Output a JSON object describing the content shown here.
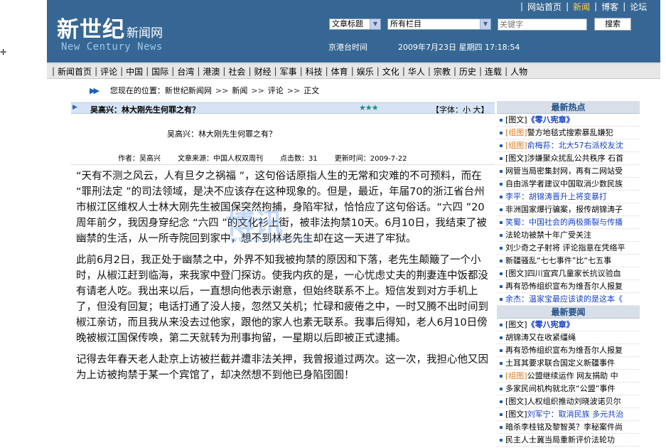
{
  "header": {
    "logo_cn": "新世纪",
    "logo_sub": "新闻网",
    "logo_en": "New Century News",
    "search_field_select": "文章标题",
    "search_column_select": "所有栏目",
    "keyword_placeholder": "关键字",
    "search_button": "搜索",
    "time_label": "京港台时间",
    "datetime": "2009年7月23日 星期四 17:18:54",
    "top_links": [
      "网站首页",
      "新闻",
      "博客",
      "论坛"
    ]
  },
  "nav": [
    "新闻首页",
    "评论",
    "中国",
    "国际",
    "台湾",
    "港澳",
    "社会",
    "财经",
    "军事",
    "科技",
    "体育",
    "娱乐",
    "文化",
    "华人",
    "宗教",
    "历史",
    "连载",
    "人物"
  ],
  "breadcrumb": {
    "label": "您现在的位置：",
    "items": [
      "新世纪新闻网",
      "新闻",
      "评论",
      "正文"
    ]
  },
  "article": {
    "bar_title": "吴高兴：林大刚先生何罪之有？",
    "stars": "★★★",
    "font_control": "【字体：小 大】",
    "title": "吴高兴：林大刚先生何罪之有？",
    "author": "作者：吴高兴",
    "source": "文章来源：中国人权双周刊",
    "clicks": "点击数：31",
    "updated": "更新时间：2009-7-22",
    "paragraphs": [
      "“天有不测之风云，人有旦夕之祸福 ”，这句俗话原指人生的无常和灾难的不可预料，而在 “罪刑法定 ”的司法领域，是决不应该存在这种现象的。但是，最近，年届70的浙江省台州市椒江区维权人士林大刚先生被国保突然拘捕，身陷牢狱，恰恰应了这句俗话。“六四 ”20周年前夕，我因身穿纪念 “六四 ”的文化衫上街，被非法拘禁10天。6月10日，我结束了被幽禁的生活，从一所寺院回到家中，想不到林老先生却在这一天进了牢狱。",
      "此前6月2日，我正处于幽禁之中，外界不知我被拘禁的原因和下落，老先生颠簸了一个小时，从椒江赶到临海，来我家中登门探访。使我内疚的是，一心忧虑丈夫的荆妻连中饭都没有请老人吃。我出来以后，一直想向他表示谢意，但始终联系不上。短信发到对方手机上了，但没有回复；电话打通了没人接，忽然又关机；忙碌和疲倦之中，一时又腾不出时间到椒江亲访，而且我从来没去过他家，跟他的家人也素无联系。我事后得知，老人6月10日傍晚被椒江国保传唤，第二天就转为刑事拘留，一星期以后即被正式逮捕。",
      "记得去年春天老人赴京上访被拦截并遭非法关押，我曾报道过两次。这一次，我担心他又因为上访被拘禁于某一个宾馆了，却决然想不到他已身陷囹圄！"
    ]
  },
  "watermark": {
    "big": "博讯",
    "small": "www.boxun.com"
  },
  "sidebar": {
    "hot_title": "最新热点",
    "hot_items": [
      {
        "tag": "[图文]",
        "tag_style": "black",
        "text": "《零八宪章》",
        "style": "blue bold"
      },
      {
        "tag": "[组图]",
        "tag_style": "orange",
        "text": "警方地毯式搜索暴乱嫌犯",
        "style": "black"
      },
      {
        "tag": "[组图]",
        "tag_style": "orange",
        "text": "俞梅荪：北大57右派校友沈",
        "style": "blue"
      },
      {
        "tag": "[图文]",
        "tag_style": "black",
        "text": "涉嫌聚众扰乱公共秩序 石首",
        "style": "black"
      },
      {
        "tag": "",
        "tag_style": "black",
        "text": "网管当局密集封网，再有二网站受",
        "style": "black"
      },
      {
        "tag": "",
        "tag_style": "black",
        "text": "自由派学者建议中国取消少数民族",
        "style": "black"
      },
      {
        "tag": "",
        "tag_style": "black",
        "text": "李平：胡锦涛晋升上将变暴打",
        "style": "blue"
      },
      {
        "tag": "",
        "tag_style": "black",
        "text": "非洲国家爆行骗案，报传胡锦涛子",
        "style": "black"
      },
      {
        "tag": "",
        "tag_style": "black",
        "text": "笑蜀：中国社会的两极撕裂与传播",
        "style": "blue"
      },
      {
        "tag": "",
        "tag_style": "black",
        "text": "法轮功被禁十年广受关注",
        "style": "black"
      },
      {
        "tag": "",
        "tag_style": "black",
        "text": "刘少奇之子射将 评论指意在凭络平",
        "style": "black"
      },
      {
        "tag": "",
        "tag_style": "black",
        "text": "新疆骚乱“七七事件”比“七五事",
        "style": "black"
      },
      {
        "tag": "[图文]",
        "tag_style": "black",
        "text": "四川宜宾几童家长抗议验血",
        "style": "black"
      },
      {
        "tag": "",
        "tag_style": "black",
        "text": "再有恐怖组织宣布为维吾尔人报复",
        "style": "black"
      },
      {
        "tag": "",
        "tag_style": "black",
        "text": "余杰：温家宝最应该读的是这本《",
        "style": "blue"
      }
    ],
    "important_title": "最新要闻",
    "important_items": [
      {
        "tag": "[图文]",
        "tag_style": "black",
        "text": "《零八宪章》",
        "style": "blue bold"
      },
      {
        "tag": "",
        "tag_style": "black",
        "text": "胡锦涛又在收紧缰绳",
        "style": "black"
      },
      {
        "tag": "",
        "tag_style": "black",
        "text": "再有恐怖组织宣布为维吾尔人报复",
        "style": "black"
      },
      {
        "tag": "",
        "tag_style": "black",
        "text": "土耳其要求联合国定义新疆事件",
        "style": "black"
      },
      {
        "tag": "[组图]",
        "tag_style": "orange",
        "text": "公盟继续运作 网友捐助 中",
        "style": "black"
      },
      {
        "tag": "",
        "tag_style": "black",
        "text": "多家民间机构就北京“公盟”事件",
        "style": "black"
      },
      {
        "tag": "[图文]",
        "tag_style": "black",
        "text": "人权组织推动刘晓波诺贝尔",
        "style": "black"
      },
      {
        "tag": "[图文]",
        "tag_style": "black",
        "text": "刘军宁：取消民族 多元共治",
        "style": "blue"
      },
      {
        "tag": "",
        "tag_style": "black",
        "text": "暗杀李桂铭及黎智英？李秘案件尚",
        "style": "black"
      },
      {
        "tag": "",
        "tag_style": "black",
        "text": "民主人士冀当局重新评价法轮功",
        "style": "black"
      }
    ]
  },
  "colors": {
    "header_bg": "#366794",
    "nav_bg": "#e7e7e7",
    "title_bar_bg": "#d6e3f4",
    "link_blue": "#1640c6",
    "tag_orange": "#e0791b",
    "active_link": "#ffd33d"
  }
}
